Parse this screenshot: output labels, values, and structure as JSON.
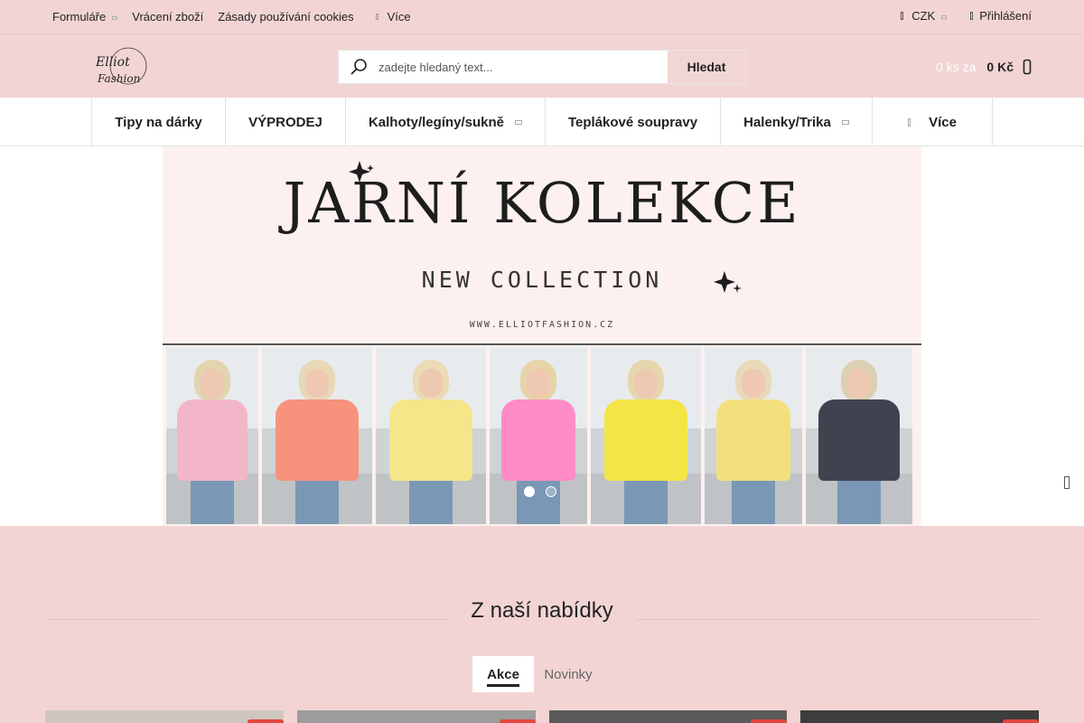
{
  "topbar": {
    "links": [
      {
        "label": "Formuláře",
        "dropdown": true
      },
      {
        "label": "Vrácení zboží",
        "dropdown": false
      },
      {
        "label": "Zásady používání cookies",
        "dropdown": false
      },
      {
        "label": "Více",
        "dropdown": false
      }
    ],
    "currency": "CZK",
    "login": "Přihlášení"
  },
  "header": {
    "logo_text": "Elliot Fashion",
    "search": {
      "placeholder": "zadejte hledaný text...",
      "button": "Hledat"
    },
    "cart": {
      "count": "0 ks za",
      "price": "0 Kč"
    }
  },
  "nav": {
    "items": [
      {
        "label": "Tipy na dárky"
      },
      {
        "label": "VÝPRODEJ"
      },
      {
        "label": "Kalhoty/legíny/sukně"
      },
      {
        "label": "Teplákové soupravy"
      },
      {
        "label": "Halenky/Trika"
      },
      {
        "label": "Více"
      }
    ]
  },
  "banner": {
    "title": "JARNÍ KOLEKCE",
    "subtitle": "NEW COLLECTION",
    "url": "WWW.ELLIOTFASHION.CZ",
    "slides": 2,
    "active_slide": 1,
    "jackets": [
      "#f2b6c8",
      "#f7927c",
      "#f5e68a",
      "#ff8cc6",
      "#f4e546",
      "#f3e07d",
      "#3f4350"
    ]
  },
  "offer": {
    "title": "Z naší nabídky",
    "tabs": [
      {
        "label": "Akce",
        "active": true
      },
      {
        "label": "Novinky",
        "active": false
      }
    ]
  },
  "colors": {
    "background": "#f3d4d4",
    "accent_red": "#e2463f",
    "text": "#222222"
  }
}
